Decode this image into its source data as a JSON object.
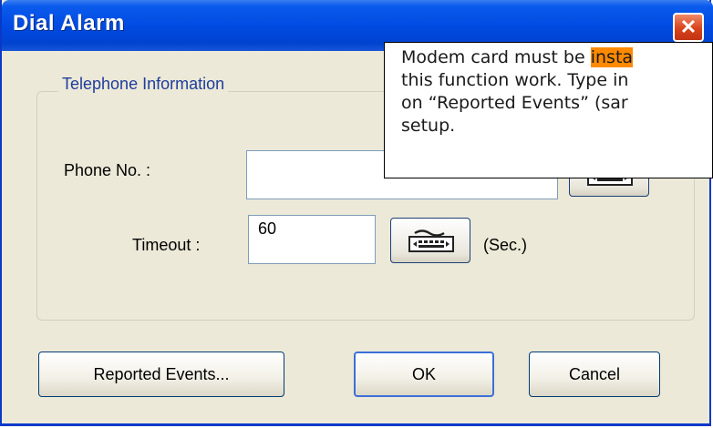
{
  "window": {
    "title": "Dial Alarm",
    "close_glyph": "✕"
  },
  "group": {
    "legend": "Telephone Information"
  },
  "phone": {
    "label": "Phone No. :",
    "value": ""
  },
  "timeout": {
    "label": "Timeout :",
    "value": "60",
    "unit": "(Sec.)"
  },
  "buttons": {
    "reported_events": "Reported Events...",
    "ok": "OK",
    "cancel": "Cancel"
  },
  "icons": {
    "keypad": "keyboard-icon"
  },
  "callout": {
    "line1_a": "Modem card must be ",
    "line1_b": "insta",
    "line2": "this function work. Type in",
    "line3": "on “Reported Events” (sar",
    "line4": "setup."
  },
  "colors": {
    "title_bar": "#0049e0",
    "dialog_bg": "#ece9d8",
    "legend_text": "#1f3d9c",
    "close_button": "#d8431b",
    "highlight": "#ff8a00"
  }
}
